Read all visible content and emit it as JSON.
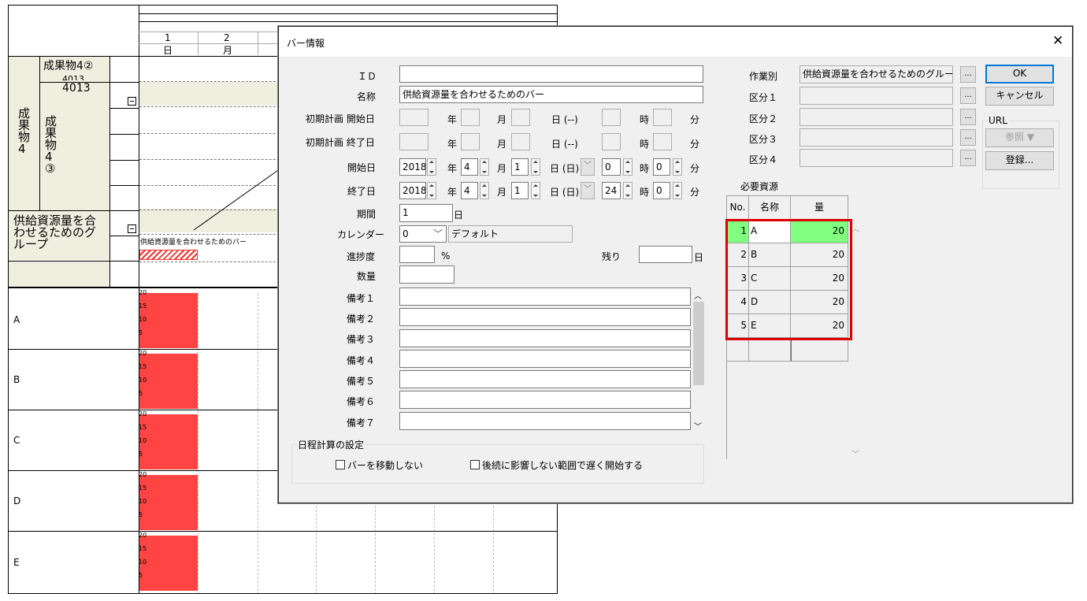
{
  "gantt": {
    "header": {
      "col1_num": "1",
      "col1_day": "日",
      "col2_num": "2",
      "col2_day": "月"
    },
    "tree": {
      "item_42": "成果物4②",
      "item_42_id_top": "4013",
      "item_42_id": "4013",
      "parent": "成果物4",
      "item_43": "成果物4③",
      "group": "供給資源量を合わせるためのグループ",
      "bar_label": "供給資源量を合わせるためのバー"
    },
    "resources": [
      "A",
      "B",
      "C",
      "D",
      "E"
    ],
    "ticks": [
      "20",
      "15",
      "10",
      "5"
    ]
  },
  "dialog": {
    "title": "バー情報",
    "fields": {
      "id_label": "ＩＤ",
      "id_value": "",
      "name_label": "名称",
      "name_value": "供給資源量を合わせるためのバー",
      "init_start_label": "初期計画 開始日",
      "init_end_label": "初期計画 終了日",
      "start_label": "開始日",
      "end_label": "終了日",
      "year": "年",
      "month": "月",
      "day_placeholder": "日 (--)",
      "day_sun": "日 (日)",
      "hour": "時",
      "minute": "分",
      "start_year": "2018",
      "start_month": "4",
      "start_day": "1",
      "start_hour": "0",
      "start_min": "0",
      "end_year": "2018",
      "end_month": "4",
      "end_day": "1",
      "end_hour": "24",
      "end_min": "0",
      "duration_label": "期間",
      "duration_value": "1",
      "duration_unit": "日",
      "calendar_label": "カレンダー",
      "calendar_value": "0",
      "calendar_name": "デフォルト",
      "progress_label": "進捗度",
      "progress_unit": "%",
      "remain_label": "残り",
      "remain_unit": "日",
      "qty_label": "数量",
      "notes": [
        "備考１",
        "備考２",
        "備考３",
        "備考４",
        "備考５",
        "備考６",
        "備考７"
      ],
      "schedule_group": "日程計算の設定",
      "chk_no_move": "バーを移動しない",
      "chk_late_start": "後続に影響しない範囲で遅く開始する"
    },
    "right": {
      "work_label": "作業別",
      "work_value": "供給資源量を合わせるためのグループ",
      "class1": "区分１",
      "class2": "区分２",
      "class3": "区分３",
      "class4": "区分４",
      "ellipsis": "...",
      "ok": "OK",
      "cancel": "キャンセル",
      "url_group": "URL",
      "browse": "参照 ▼",
      "register": "登録...",
      "res_title": "必要資源",
      "res_headers": {
        "no": "No.",
        "name": "名称",
        "qty": "量"
      },
      "res_rows": [
        {
          "no": "1",
          "name": "A",
          "qty": "20"
        },
        {
          "no": "2",
          "name": "B",
          "qty": "20"
        },
        {
          "no": "3",
          "name": "C",
          "qty": "20"
        },
        {
          "no": "4",
          "name": "D",
          "qty": "20"
        },
        {
          "no": "5",
          "name": "E",
          "qty": "20"
        }
      ]
    },
    "colors": {
      "selected_row": "#80ff80",
      "highlight_border": "#dd0000",
      "bar_red": "#ff4444"
    }
  }
}
